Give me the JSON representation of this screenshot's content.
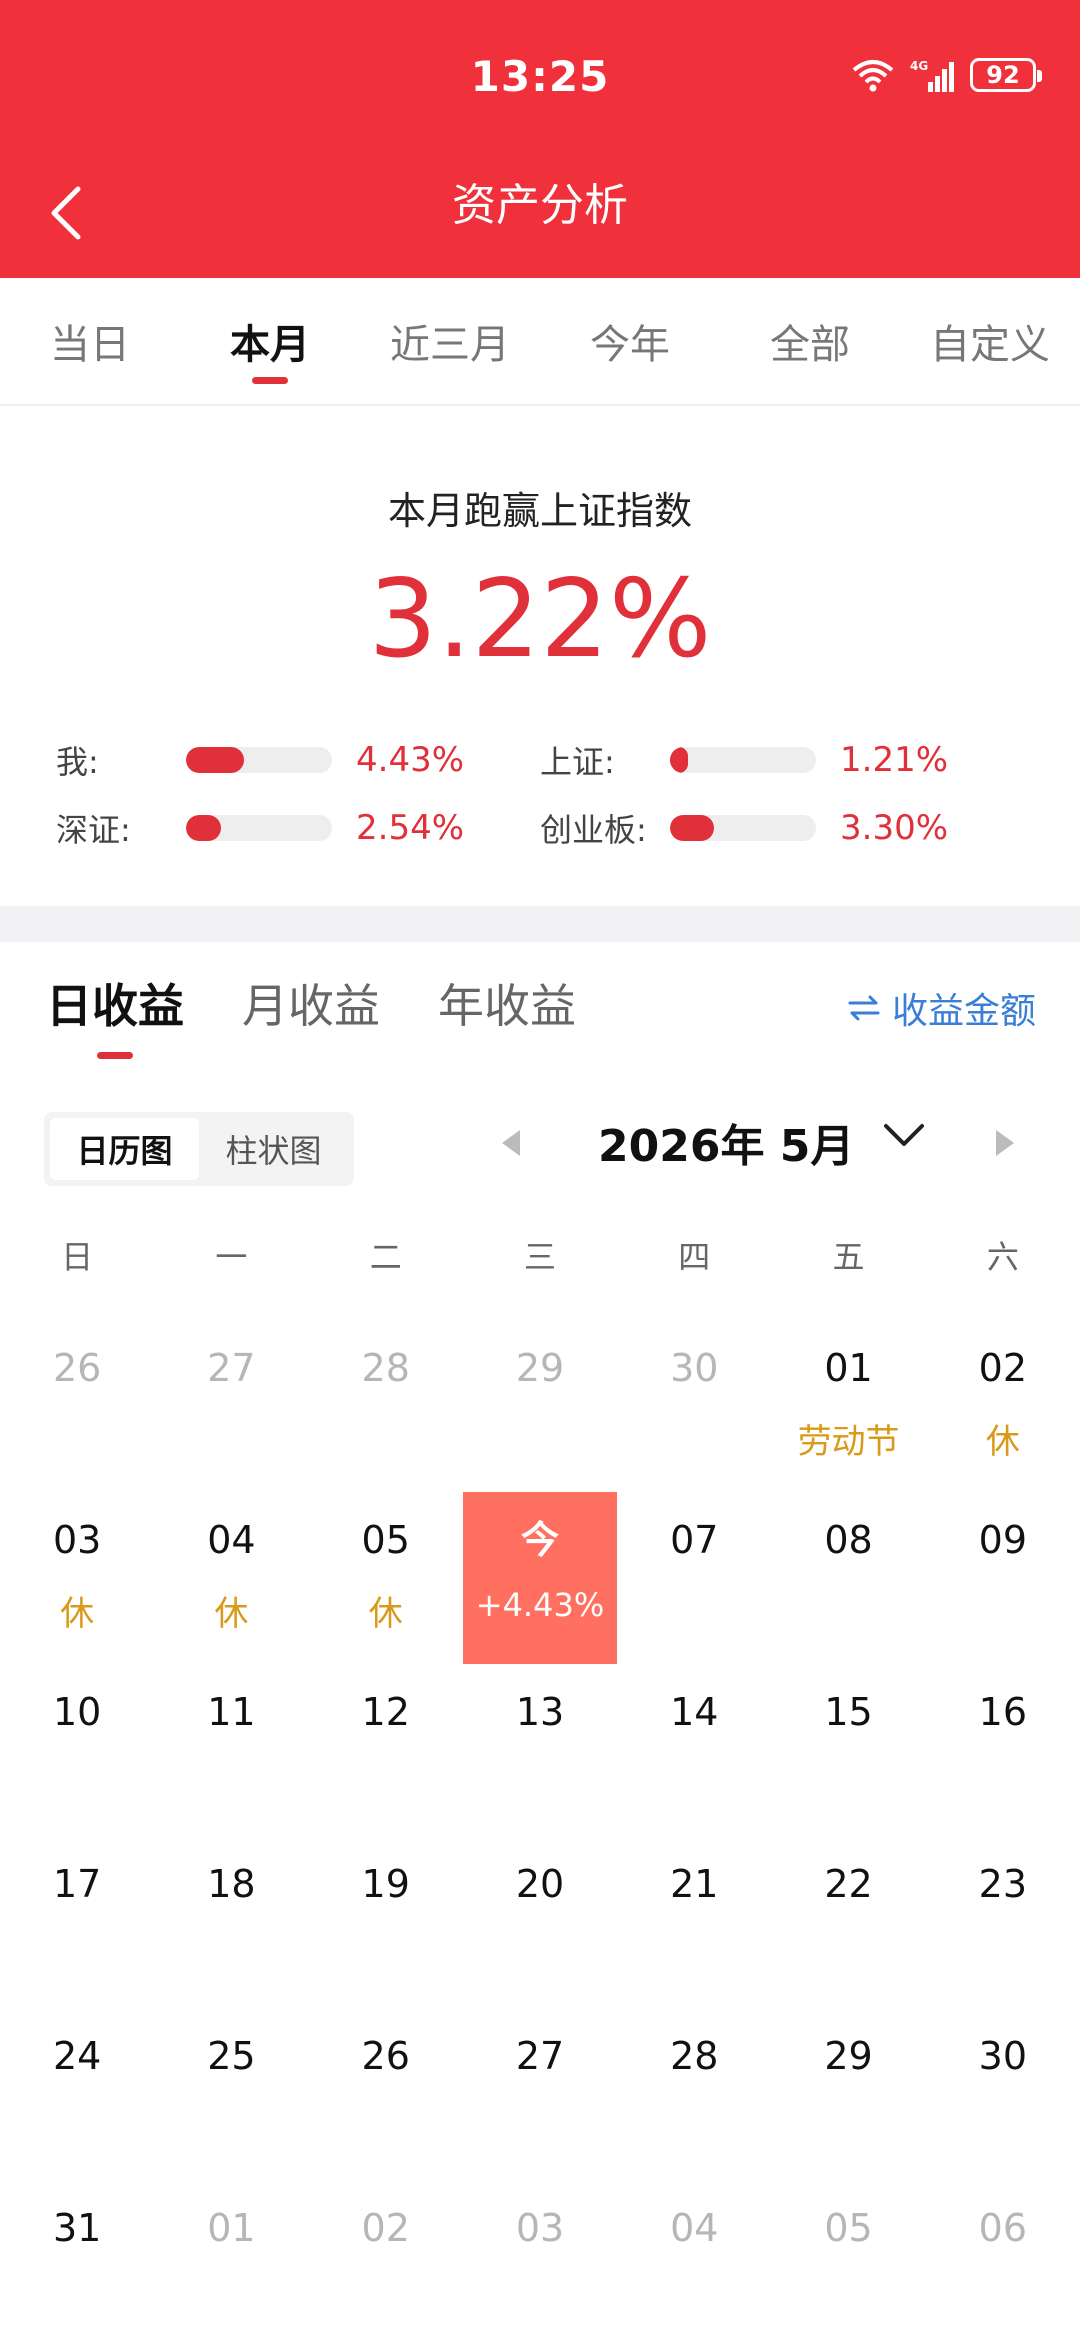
{
  "status_bar": {
    "time": "13:25",
    "battery": "92",
    "signal_label": "4G"
  },
  "header": {
    "title": "资产分析"
  },
  "period_tabs": [
    {
      "label": "当日",
      "active": false
    },
    {
      "label": "本月",
      "active": true
    },
    {
      "label": "近三月",
      "active": false
    },
    {
      "label": "今年",
      "active": false
    },
    {
      "label": "全部",
      "active": false
    },
    {
      "label": "自定义",
      "active": false
    }
  ],
  "summary": {
    "title": "本月跑赢上证指数",
    "value": "3.22%",
    "comparisons": [
      {
        "label": "我:",
        "value": "4.43%",
        "fill": 0.4
      },
      {
        "label": "上证:",
        "value": "1.21%",
        "fill": 0.11
      },
      {
        "label": "深证:",
        "value": "2.54%",
        "fill": 0.24
      },
      {
        "label": "创业板:",
        "value": "3.30%",
        "fill": 0.3
      }
    ]
  },
  "income": {
    "tabs": [
      {
        "label": "日收益",
        "active": true
      },
      {
        "label": "月收益",
        "active": false
      },
      {
        "label": "年收益",
        "active": false
      }
    ],
    "amount_toggle": "收益金额",
    "view_options": [
      {
        "label": "日历图",
        "active": true
      },
      {
        "label": "柱状图",
        "active": false
      }
    ],
    "month_label": "2026年 5月"
  },
  "calendar": {
    "weekdays": [
      "日",
      "一",
      "二",
      "三",
      "四",
      "五",
      "六"
    ],
    "days": [
      {
        "day": "26",
        "other": true
      },
      {
        "day": "27",
        "other": true
      },
      {
        "day": "28",
        "other": true
      },
      {
        "day": "29",
        "other": true
      },
      {
        "day": "30",
        "other": true
      },
      {
        "day": "01",
        "note": "劳动节"
      },
      {
        "day": "02",
        "note": "休"
      },
      {
        "day": "03",
        "note": "休"
      },
      {
        "day": "04",
        "note": "休"
      },
      {
        "day": "05",
        "note": "休"
      },
      {
        "day": "今",
        "note": "+4.43%",
        "today": true
      },
      {
        "day": "07"
      },
      {
        "day": "08"
      },
      {
        "day": "09"
      },
      {
        "day": "10"
      },
      {
        "day": "11"
      },
      {
        "day": "12"
      },
      {
        "day": "13"
      },
      {
        "day": "14"
      },
      {
        "day": "15"
      },
      {
        "day": "16"
      },
      {
        "day": "17"
      },
      {
        "day": "18"
      },
      {
        "day": "19"
      },
      {
        "day": "20"
      },
      {
        "day": "21"
      },
      {
        "day": "22"
      },
      {
        "day": "23"
      },
      {
        "day": "24"
      },
      {
        "day": "25"
      },
      {
        "day": "26"
      },
      {
        "day": "27"
      },
      {
        "day": "28"
      },
      {
        "day": "29"
      },
      {
        "day": "30"
      },
      {
        "day": "31"
      },
      {
        "day": "01",
        "other": true
      },
      {
        "day": "02",
        "other": true
      },
      {
        "day": "03",
        "other": true
      },
      {
        "day": "04",
        "other": true
      },
      {
        "day": "05",
        "other": true
      },
      {
        "day": "06",
        "other": true
      }
    ]
  },
  "colors": {
    "brand_red": "#f0303a",
    "accent_red": "#e0303a",
    "holiday": "#d99a1a",
    "today_bg": "#ff7060",
    "link_blue": "#3a7fd5"
  }
}
